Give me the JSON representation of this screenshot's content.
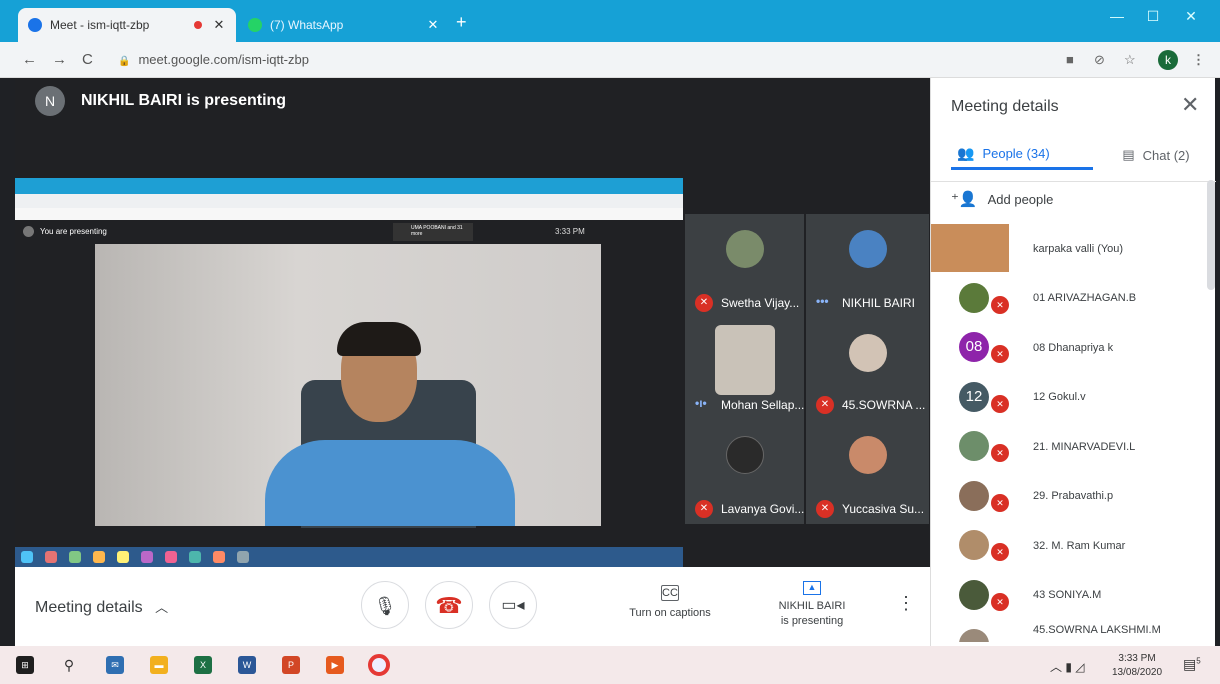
{
  "browser": {
    "tabs": [
      {
        "title": "Meet - ism-iqtt-zbp",
        "favicon_color": "#1a73e8",
        "recording": true
      },
      {
        "title": "(7) WhatsApp",
        "favicon_color": "#25d366",
        "recording": false
      }
    ],
    "url": "meet.google.com/ism-iqtt-zbp",
    "profile_initial": "k"
  },
  "stage": {
    "presenter_initial": "N",
    "presenter_text": "NIKHIL BAIRI is presenting",
    "shared_screen": {
      "you_presenting": "You are presenting",
      "mini_clock": "3:33 PM",
      "mini_host": "UMA POOBANI and 31 more"
    }
  },
  "participants_grid": [
    {
      "name": "Swetha Vijay...",
      "muted": true,
      "avatar_color": "#7a8b6a"
    },
    {
      "name": "NIKHIL BAIRI",
      "muted": false,
      "speaking": true,
      "avatar_color": "#4a82c2"
    },
    {
      "name": "Mohan Sellap...",
      "muted": false,
      "speaking": true,
      "avatar_color": "#c9c2b8"
    },
    {
      "name": "45.SOWRNA ...",
      "muted": true,
      "avatar_color": "#d2c3b5"
    },
    {
      "name": "Lavanya Govi...",
      "muted": true,
      "avatar_color": "#2a2a2a"
    },
    {
      "name": "Yuccasiva Su...",
      "muted": true,
      "avatar_color": "#c98a6a"
    }
  ],
  "sidebar": {
    "title": "Meeting details",
    "tab_people": "People (34)",
    "tab_chat": "Chat (2)",
    "add_people": "Add people",
    "people": [
      {
        "name": "karpaka valli (You)",
        "initial": "",
        "color": "#c98d5a",
        "muted": false
      },
      {
        "name": "01 ARIVAZHAGAN.B",
        "initial": "",
        "color": "#5b7a3a",
        "muted": true
      },
      {
        "name": "08 Dhanapriya k",
        "initial": "08",
        "color": "#8e24aa",
        "muted": true
      },
      {
        "name": "12 Gokul.v",
        "initial": "12",
        "color": "#455a64",
        "muted": true
      },
      {
        "name": "21. MINARVADEVI.L",
        "initial": "",
        "color": "#6d8e6a",
        "muted": true
      },
      {
        "name": "29. Prabavathi.p",
        "initial": "",
        "color": "#8a6e5a",
        "muted": true
      },
      {
        "name": "32. M. Ram Kumar",
        "initial": "",
        "color": "#b08d6a",
        "muted": true
      },
      {
        "name": "43 SONIYA.M",
        "initial": "",
        "color": "#4a5a3a",
        "muted": true
      },
      {
        "name": "45.SOWRNA LAKSHMI.M",
        "initial": "",
        "color": "#9a8a7a",
        "muted": true
      }
    ]
  },
  "bottombar": {
    "meeting_details": "Meeting details",
    "captions": "Turn on captions",
    "captions_icon": "CC",
    "presenting_line1": "NIKHIL BAIRI",
    "presenting_line2": "is presenting"
  },
  "taskbar": {
    "time": "3:33 PM",
    "date": "13/08/2020",
    "notifications": "5"
  }
}
